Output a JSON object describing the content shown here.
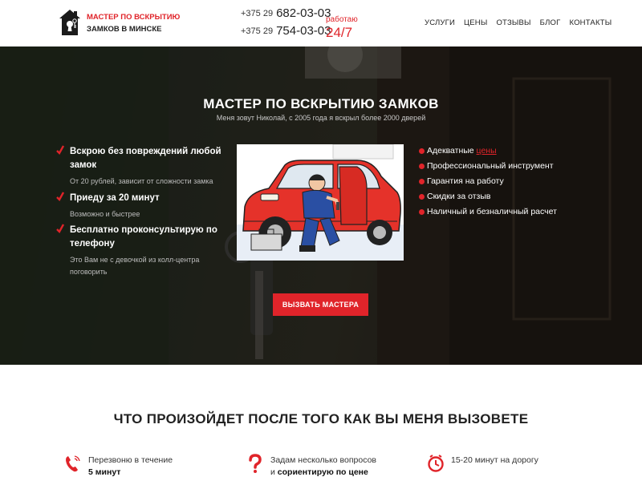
{
  "header": {
    "logo_line1": "МАСТЕР ПО ВСКРЫТИЮ",
    "logo_line2": "ЗАМКОВ В МИНСКЕ",
    "phones": [
      {
        "code": "+375 29",
        "number": "682-03-03"
      },
      {
        "code": "+375 29",
        "number": "754-03-03"
      }
    ],
    "work_label": "работаю",
    "work_hours": "24/7",
    "nav": [
      "УСЛУГИ",
      "ЦЕНЫ",
      "ОТЗЫВЫ",
      "БЛОГ",
      "КОНТАКТЫ"
    ]
  },
  "hero": {
    "title": "МАСТЕР ПО ВСКРЫТИЮ ЗАМКОВ",
    "subtitle": "Меня зовут Николай, с 2005 года я вскрыл более 2000 дверей",
    "features": [
      {
        "title": "Вскрою без повреждений любой замок",
        "sub": "От 20 рублей, зависит от сложности замка"
      },
      {
        "title": "Приеду за 20 минут",
        "sub": "Возможно и быстрее"
      },
      {
        "title": "Бесплатно проконсультирую по телефону",
        "sub": "Это Вам не с девочкой из колл-центра поговорить"
      }
    ],
    "bullets": [
      {
        "text": "Адекватные ",
        "link": "цены"
      },
      {
        "text": "Профессиональный инструмент"
      },
      {
        "text": "Гарантия на работу"
      },
      {
        "text": "Скидки за отзыв"
      },
      {
        "text": "Наличный и безналичный расчет"
      }
    ],
    "cta": "ВЫЗВАТЬ МАСТЕРА"
  },
  "after_call": {
    "title": "ЧТО ПРОИЗОЙДЕТ ПОСЛЕ ТОГО КАК ВЫ МЕНЯ ВЫЗОВЕТЕ",
    "steps": [
      {
        "icon": "phone-icon",
        "line1": "Перезвоню в течение",
        "line2": "5 минут"
      },
      {
        "icon": "question-icon",
        "line1": "Задам несколько вопросов",
        "line2_prefix": "и ",
        "line2": "сориентирую по цене"
      },
      {
        "icon": "clock-icon",
        "line1": "15-20 минут на дорогу"
      }
    ]
  },
  "colors": {
    "accent": "#e0242a",
    "text": "#222222",
    "hero_text": "#ffffff"
  }
}
